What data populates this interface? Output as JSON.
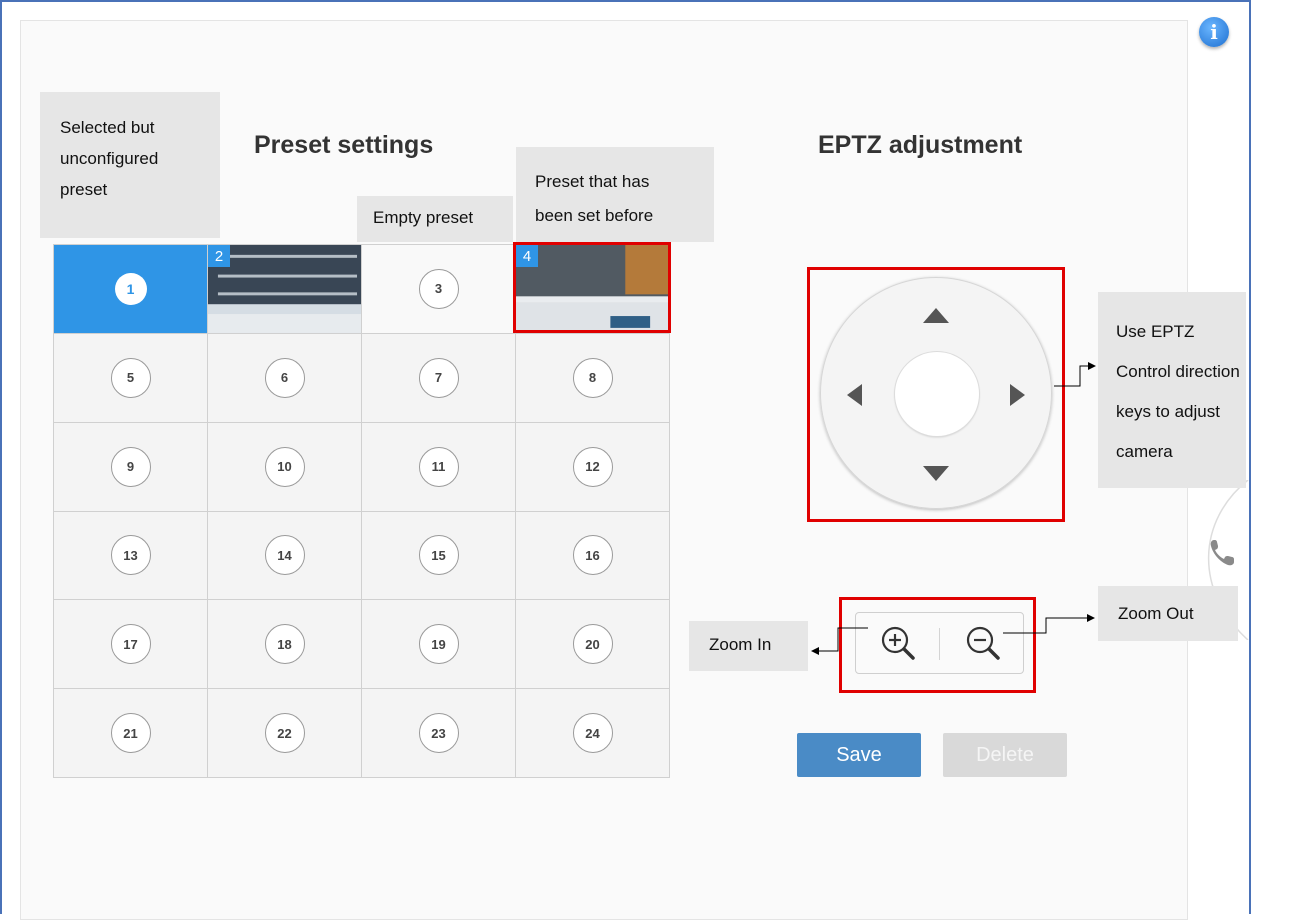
{
  "callouts": {
    "selected_unconfigured": [
      "Selected but",
      "unconfigured",
      "preset"
    ],
    "empty_preset": "Empty preset",
    "preset_set_before": [
      "Preset that has",
      "been set before"
    ],
    "eptz_control": [
      "Use EPTZ",
      "Control direction",
      "keys to adjust",
      "camera"
    ],
    "zoom_in": "Zoom In",
    "zoom_out": "Zoom Out"
  },
  "preset_section": {
    "title": "Preset settings",
    "presets": [
      "1",
      "2",
      "3",
      "4",
      "5",
      "6",
      "7",
      "8",
      "9",
      "10",
      "11",
      "12",
      "13",
      "14",
      "15",
      "16",
      "17",
      "18",
      "19",
      "20",
      "21",
      "22",
      "23",
      "24"
    ],
    "selected_preset": "1",
    "configured_presets": [
      "2",
      "4"
    ]
  },
  "eptz_section": {
    "title": "EPTZ adjustment"
  },
  "buttons": {
    "save": "Save",
    "delete": "Delete"
  },
  "icons": {
    "info": "info-icon",
    "phone": "phone-icon",
    "zoom_in": "zoom-in-icon",
    "zoom_out": "zoom-out-icon"
  },
  "colors": {
    "selected": "#2f95e6",
    "highlight": "#e00000",
    "save": "#4a8bc6",
    "delete_disabled": "#d9d9d9"
  }
}
